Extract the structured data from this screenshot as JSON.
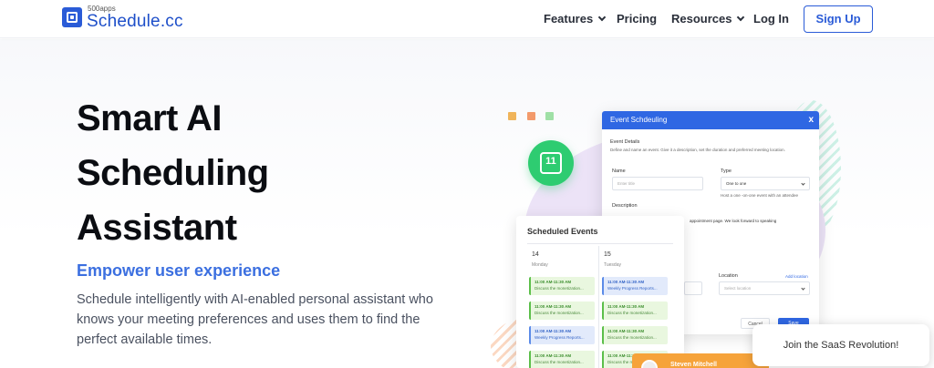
{
  "header": {
    "logo_small": "500apps",
    "logo_text": "Schedule.cc",
    "nav": [
      {
        "label": "Features",
        "has_dropdown": true
      },
      {
        "label": "Pricing",
        "has_dropdown": false
      },
      {
        "label": "Resources",
        "has_dropdown": true
      },
      {
        "label": "Log In",
        "has_dropdown": false
      }
    ],
    "signup_label": "Sign Up"
  },
  "hero": {
    "title_lines": [
      "Smart AI",
      "Scheduling",
      "Assistant"
    ],
    "subtitle": "Empower user experience",
    "description": "Schedule intelligently with AI-enabled personal assistant who knows your meeting preferences and uses them to find the perfect available times."
  },
  "colors": {
    "brand": "#2a5bd7",
    "accent": "#3b6fe0",
    "decor_squares": [
      "#f0b45a",
      "#f39a6b",
      "#9fe0a6"
    ],
    "icon_green": "#2ecc71",
    "person_orange": "#f6a33a"
  },
  "illustration": {
    "calendar_icon_number": "11",
    "modal": {
      "title": "Event Schdeuling",
      "close": "x",
      "section_title": "Event Details",
      "section_desc": "Define and name an event. Give it a description, set the duration and preferred meeting location.",
      "name_label": "Name",
      "name_placeholder": "Enter title",
      "type_label": "Type",
      "type_value": "One to one",
      "type_hint": "Host a one -on-one event with an attendee",
      "description_label": "Description",
      "description_text": "appointment page. We look forward to speaking",
      "location_label": "Location",
      "add_location": "Add location",
      "location_placeholder": "Select location",
      "cancel_label": "Cancel",
      "save_label": "Save"
    },
    "events": {
      "title": "Scheduled Events",
      "days": [
        {
          "number": "14",
          "name": "Monday",
          "items": [
            {
              "time": "11:00 AM-11:30 AM",
              "text": "Discuss the monetization...",
              "color": "green"
            },
            {
              "time": "11:00 AM-11:30 AM",
              "text": "Discuss the monetization...",
              "color": "green"
            },
            {
              "time": "11:00 AM-11:30 AM",
              "text": "Weekly Progress Reports...",
              "color": "blue"
            },
            {
              "time": "11:00 AM-11:30 AM",
              "text": "Discuss the monetization...",
              "color": "green"
            }
          ]
        },
        {
          "number": "15",
          "name": "Tuesday",
          "items": [
            {
              "time": "11:00 AM-11:30 AM",
              "text": "Weekly Progress Reports...",
              "color": "blue"
            },
            {
              "time": "11:00 AM-11:30 AM",
              "text": "Discuss the monetization...",
              "color": "green"
            },
            {
              "time": "11:00 AM-11:30 AM",
              "text": "Discuss the monetization...",
              "color": "green"
            },
            {
              "time": "11:00 AM-11:30 AM",
              "text": "Discuss the monetization...",
              "color": "green"
            }
          ]
        }
      ]
    },
    "person_name": "Steven Mitchell"
  },
  "chat_widget": {
    "label": "Join the SaaS Revolution!"
  }
}
